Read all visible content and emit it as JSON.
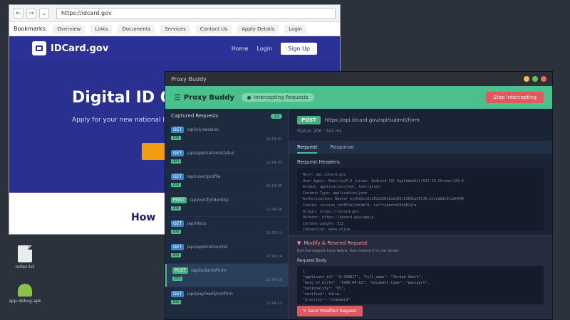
{
  "browser": {
    "url": "https://idcard.gov",
    "nav": {
      "back": "←",
      "forward": "→",
      "menu": "⌄"
    },
    "bookmarks_label": "Bookmarks:",
    "bookmarks": [
      "Overview",
      "Links",
      "Documents",
      "Services",
      "Contact Us",
      "Apply Details",
      "Login"
    ],
    "site": {
      "logo": "IDCard.gov",
      "nav_home": "Home",
      "nav_login": "Login",
      "nav_signup": "Sign Up",
      "hero_title": "Digital ID Ca",
      "hero_sub": "Apply for your new national ID ca",
      "how": "How"
    }
  },
  "desktop_icons": [
    {
      "name": "document-file",
      "label": "notes.txt"
    },
    {
      "name": "android-app",
      "label": "app-debug.apk"
    }
  ],
  "proxy": {
    "window_title": "Proxy Buddy",
    "app_name": "Proxy Buddy",
    "intercept_status": "Intercepting Requests",
    "stop_button": "Stop Intercepting",
    "sidebar_title": "Captured Requests",
    "sidebar_count": "12",
    "requests": [
      {
        "method": "GET",
        "path": "/api/v1/session",
        "status": "200",
        "time": "12:04:01"
      },
      {
        "method": "GET",
        "path": "/api/application/status",
        "status": "200",
        "time": "12:04:03"
      },
      {
        "method": "GET",
        "path": "/api/user/profile",
        "status": "200",
        "time": "12:04:05"
      },
      {
        "method": "POST",
        "path": "/api/verify/identity",
        "status": "200",
        "time": "12:04:08"
      },
      {
        "method": "GET",
        "path": "/api/docs",
        "status": "200",
        "time": "12:04:11"
      },
      {
        "method": "GET",
        "path": "/api/application/list",
        "status": "200",
        "time": "12:04:14"
      },
      {
        "method": "POST",
        "path": "/api/submit/form",
        "status": "200",
        "time": "12:04:18"
      },
      {
        "method": "GET",
        "path": "/api/payment/confirm",
        "status": "200",
        "time": "12:04:22"
      }
    ],
    "selected_index": 6,
    "detail": {
      "method": "POST",
      "url": "https://api.idcard.gov/api/submit/form",
      "meta": "Status: 200 · 342 ms",
      "tabs": [
        "Request",
        "Response"
      ],
      "section_title": "Request Headers",
      "code_lines": [
        "Host: api.idcard.gov",
        "User-Agent: Mozilla/5.0 (Linux; Android 13) AppleWebKit/537.36 Chrome/120.0",
        "Accept: application/json, text/plain",
        "Content-Type: application/json",
        "Authorization: Bearer eyJhbGciOiJIUzI1NiIsInR5cCI6IkpXVCJ9.eyJzdWIiOiIxMjM0",
        "Cookie: session_id=8f2a1c9e4b7d; csrftoken=a93kd82jfa",
        "Origin: https://idcard.gov",
        "Referer: https://idcard.gov/apply",
        "Content-Length: 512",
        "Connection: keep-alive"
      ]
    },
    "modify": {
      "title": "Modify & Resend Request",
      "desc": "Edit the request body below, then resend it to the server.",
      "label": "Request Body",
      "code_lines": [
        "{",
        "  \"applicant_id\": \"A-204817\", \"full_name\": \"Jordan Smith\",",
        "  \"date_of_birth\": \"1990-04-12\", \"document_type\": \"passport\",",
        "  \"nationality\": \"US\",",
        "  \"verified\": false,",
        "  \"priority\": \"standard\"",
        "}"
      ],
      "send_button": "Send Modified Request"
    }
  },
  "colors": {
    "accent": "#4cbf8f",
    "danger": "#e0595f",
    "site_brand": "#2b3196",
    "cta": "#f29c12"
  }
}
